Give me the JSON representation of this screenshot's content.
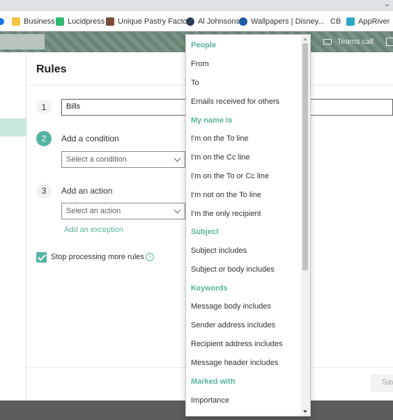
{
  "browser": {
    "menu_icon": "kebab-menu-icon",
    "bookmarks": [
      {
        "label": "",
        "icon": "chrome-icon",
        "color": "#1a73e8"
      },
      {
        "label": "Business",
        "icon": "folder-icon",
        "color": "#f5c342"
      },
      {
        "label": "Lucidpress",
        "icon": "lucidpress-icon",
        "color": "#2eb872"
      },
      {
        "label": "Unique Pastry Facto...",
        "icon": "pastry-icon",
        "color": "#7a4b3a"
      },
      {
        "label": "Al Johnsons",
        "icon": "al-johnsons-icon",
        "color": "#2e3d56"
      },
      {
        "label": "Wallpapers | Disney...",
        "icon": "disney-icon",
        "color": "#1f5aa8"
      },
      {
        "label": "CB",
        "icon": "",
        "color": ""
      },
      {
        "label": "AppRiver",
        "icon": "appriver-icon",
        "color": "#2aa6c9"
      }
    ]
  },
  "header": {
    "teams_call_label": "Teams call"
  },
  "dialog": {
    "title": "Rules",
    "step1_number": "1",
    "rule_name_value": "Bills",
    "step2_number": "2",
    "step2_label": "Add a condition",
    "condition_placeholder": "Select a condition",
    "step3_number": "3",
    "step3_label": "Add an action",
    "action_placeholder": "Select an action",
    "exception_link": "Add an exception",
    "stop_processing_label": "Stop processing more rules",
    "stop_processing_checked": true,
    "info_glyph": "i",
    "save_label": "Sav"
  },
  "dropdown": {
    "groups": [
      {
        "header": "People",
        "items": [
          "From",
          "To",
          "Emails received for others"
        ]
      },
      {
        "header": "My name is",
        "items": [
          "I'm on the To line",
          "I'm on the Cc line",
          "I'm on the To or Cc line",
          "I'm not on the To line",
          "I'm the only recipient"
        ]
      },
      {
        "header": "Subject",
        "items": [
          "Subject includes",
          "Subject or body includes"
        ]
      },
      {
        "header": "Keywords",
        "items": [
          "Message body includes",
          "Sender address includes",
          "Recipient address includes",
          "Message header includes"
        ]
      },
      {
        "header": "Marked with",
        "items": [
          "Importance"
        ]
      }
    ]
  },
  "colors": {
    "accent": "#56b3a1",
    "header_bg": "#6e8a7a"
  }
}
